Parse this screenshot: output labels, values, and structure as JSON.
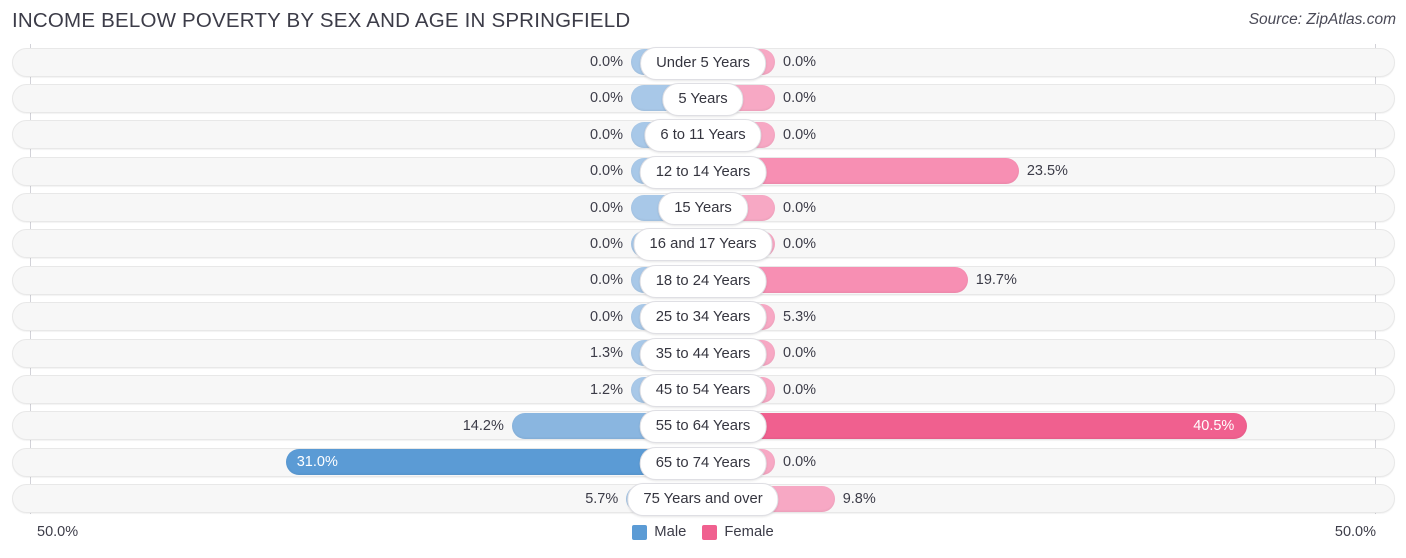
{
  "header": {
    "title": "INCOME BELOW POVERTY BY SEX AND AGE IN SPRINGFIELD",
    "source": "Source: ZipAtlas.com"
  },
  "axis": {
    "left_tick": "50.0%",
    "right_tick": "50.0%",
    "max": 50.0
  },
  "legend": {
    "items": [
      {
        "label": "Male",
        "color": "#5b9bd5"
      },
      {
        "label": "Female",
        "color": "#f0608f"
      }
    ]
  },
  "colors": {
    "male_light": "#a8c8e8",
    "male_mid": "#8ab6e0",
    "male_dark": "#5b9bd5",
    "female_light": "#f7a8c4",
    "female_mid": "#f78fb3",
    "female_dark": "#f0608f",
    "track": "#f7f7f7",
    "track_border": "#e8e8e8"
  },
  "chart_data": {
    "type": "bar",
    "title": "INCOME BELOW POVERTY BY SEX AND AGE IN SPRINGFIELD",
    "subtitle": "",
    "xlabel": "",
    "ylabel": "",
    "orientation": "horizontal-diverging",
    "xlim": [
      0,
      50.0
    ],
    "grid": false,
    "legend_position": "bottom-center",
    "categories": [
      "Under 5 Years",
      "5 Years",
      "6 to 11 Years",
      "12 to 14 Years",
      "15 Years",
      "16 and 17 Years",
      "18 to 24 Years",
      "25 to 34 Years",
      "35 to 44 Years",
      "45 to 54 Years",
      "55 to 64 Years",
      "65 to 74 Years",
      "75 Years and over"
    ],
    "series": [
      {
        "name": "Male",
        "values": [
          0.0,
          0.0,
          0.0,
          0.0,
          0.0,
          0.0,
          0.0,
          0.0,
          1.3,
          1.2,
          14.2,
          31.0,
          5.7
        ],
        "labels": [
          "0.0%",
          "0.0%",
          "0.0%",
          "0.0%",
          "0.0%",
          "0.0%",
          "0.0%",
          "0.0%",
          "1.3%",
          "1.2%",
          "14.2%",
          "31.0%",
          "5.7%"
        ]
      },
      {
        "name": "Female",
        "values": [
          0.0,
          0.0,
          0.0,
          23.5,
          0.0,
          0.0,
          19.7,
          5.3,
          0.0,
          0.0,
          40.5,
          0.0,
          9.8
        ],
        "labels": [
          "0.0%",
          "0.0%",
          "0.0%",
          "23.5%",
          "0.0%",
          "0.0%",
          "19.7%",
          "5.3%",
          "0.0%",
          "0.0%",
          "40.5%",
          "0.0%",
          "9.8%"
        ]
      }
    ]
  }
}
